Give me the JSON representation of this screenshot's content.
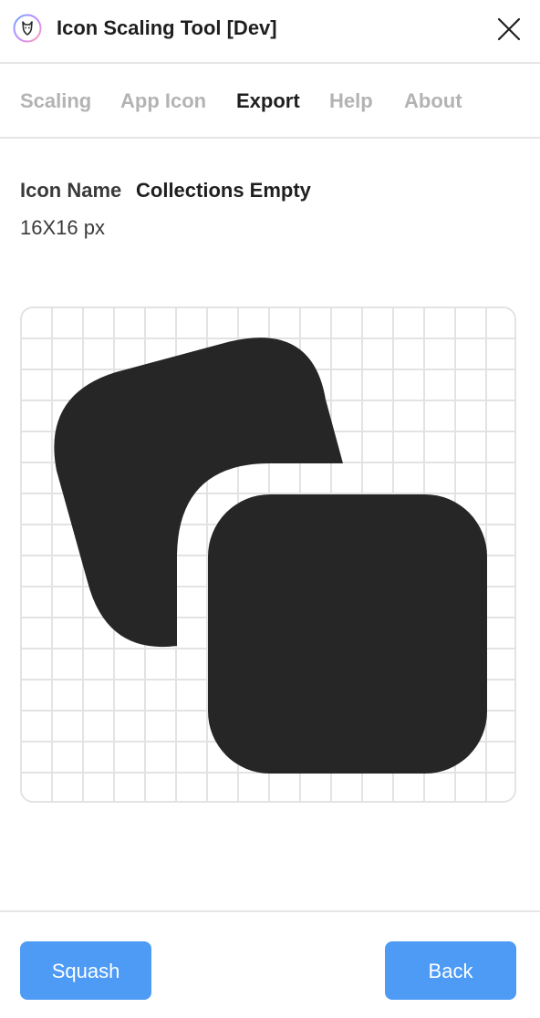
{
  "window": {
    "title": "Icon Scaling Tool [Dev]",
    "logo_icon": "plugin-logo-icon",
    "close_icon": "close-icon"
  },
  "tabs": [
    {
      "label": "Scaling",
      "active": false
    },
    {
      "label": "App Icon",
      "active": false
    },
    {
      "label": "Export",
      "active": true
    },
    {
      "label": "Help",
      "active": false
    },
    {
      "label": "About",
      "active": false
    }
  ],
  "icon_info": {
    "name_label": "Icon Name",
    "name_value": "Collections Empty",
    "size": "16X16 px"
  },
  "preview": {
    "icon": "collections-empty-icon",
    "grid": true,
    "icon_color": "#262626"
  },
  "footer": {
    "squash_label": "Squash",
    "back_label": "Back"
  },
  "colors": {
    "accent": "#4d9bf5",
    "tab_inactive": "#b3b3b3",
    "text": "#1f1f1f",
    "grid": "#e3e3e3"
  }
}
